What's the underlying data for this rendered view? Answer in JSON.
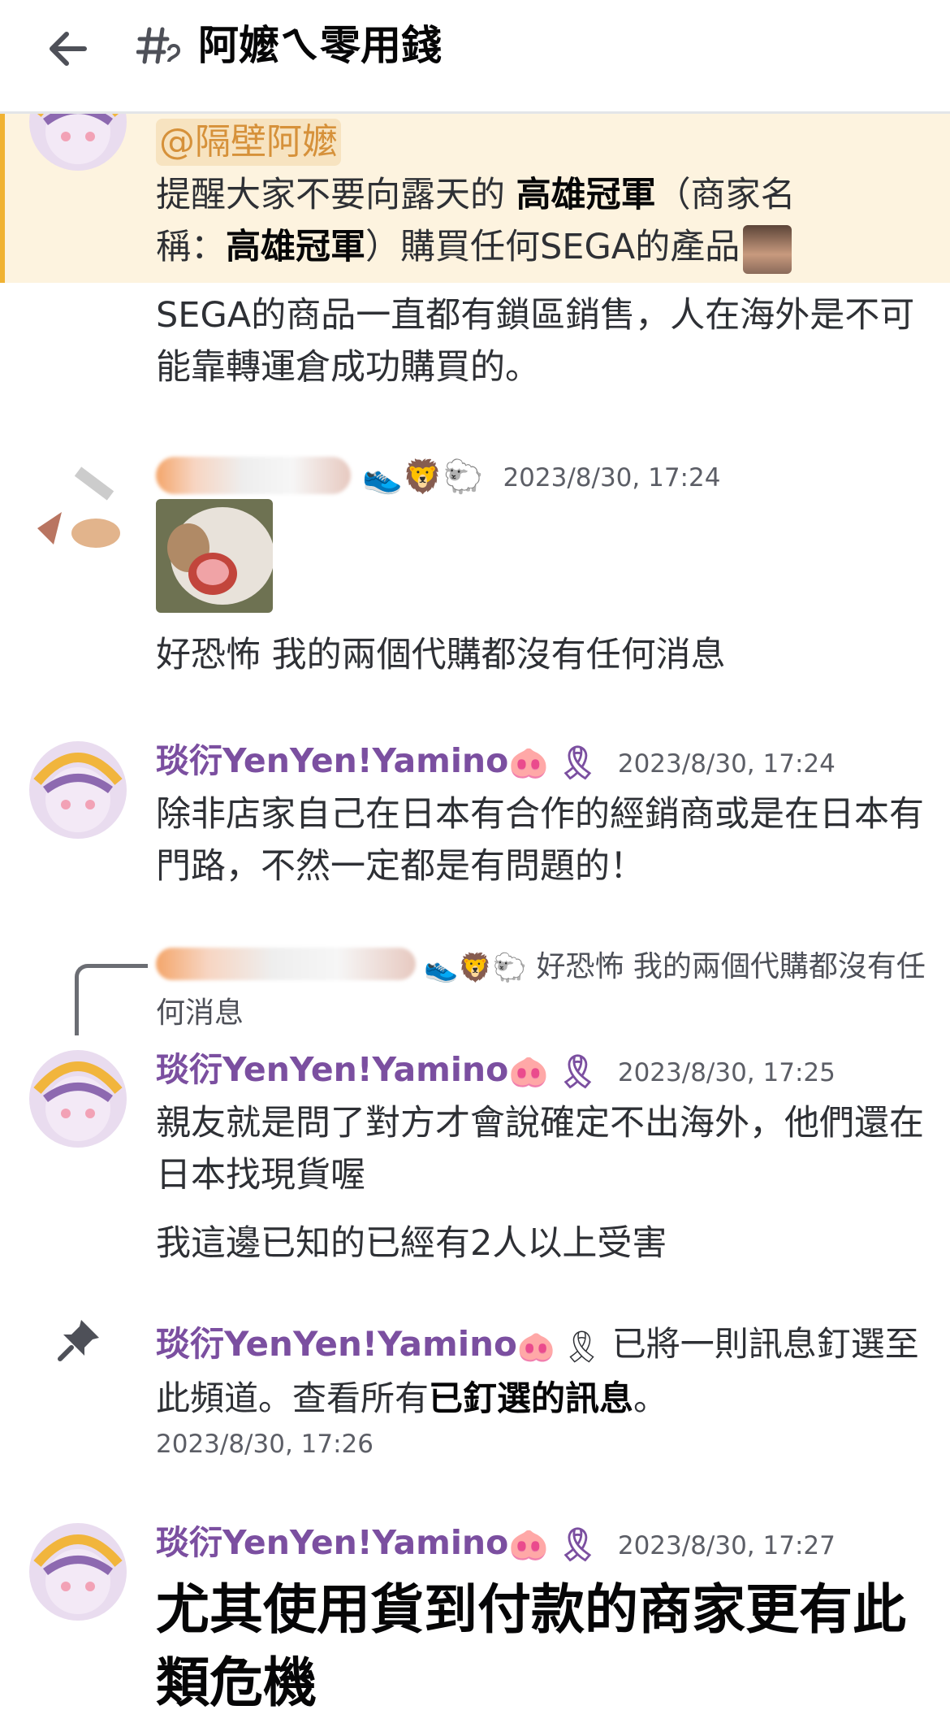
{
  "header": {
    "title": "阿嬤ㄟ零用錢",
    "back_icon": "arrow-left-icon",
    "channel_icon": "thread-hash-icon"
  },
  "colors": {
    "username": "#7b4fa0",
    "mention_bg": "#fdf3df",
    "mention_bar": "#f0b232",
    "mention_tag": "#d6913a"
  },
  "messages": {
    "m1": {
      "mention": "@隔壁阿嬤",
      "line1_a": "提醒大家不要向露天的 ",
      "line1_b": "高雄冠軍",
      "line1_c": "（商家名",
      "line2_a": "稱：",
      "line2_b": "高雄冠軍",
      "line2_c": "）購買任何SEGA的產品",
      "followup": "SEGA的商品一直都有鎖區銷售，人在海外是不可能靠轉運倉成功購買的。"
    },
    "m2": {
      "timestamp": "2023/8/30, 17:24",
      "text": "好恐怖 我的兩個代購都沒有任何消息"
    },
    "m3": {
      "username": "琰衍YenYen!Yamino",
      "timestamp": "2023/8/30, 17:24",
      "text": "除非店家自己在日本有合作的經銷商或是在日本有門路，不然一定都是有問題的！"
    },
    "reply": {
      "text": "好恐怖 我的兩個代購都沒有任何消息"
    },
    "m4": {
      "username": "琰衍YenYen!Yamino",
      "timestamp": "2023/8/30, 17:25",
      "text1": "親友就是問了對方才會說確定不出海外，他們還在日本找現貨喔",
      "text2": "我這邊已知的已經有2人以上受害"
    },
    "system": {
      "username": "琰衍YenYen!Yamino",
      "action": " 已將一則訊息釘選至此頻道。查看所有",
      "link": "已釘選的訊息",
      "end": "。",
      "timestamp": "2023/8/30, 17:26"
    },
    "m5": {
      "username": "琰衍YenYen!Yamino",
      "timestamp": "2023/8/30, 17:27",
      "text": "尤其使用貨到付款的商家更有此類危機"
    }
  }
}
